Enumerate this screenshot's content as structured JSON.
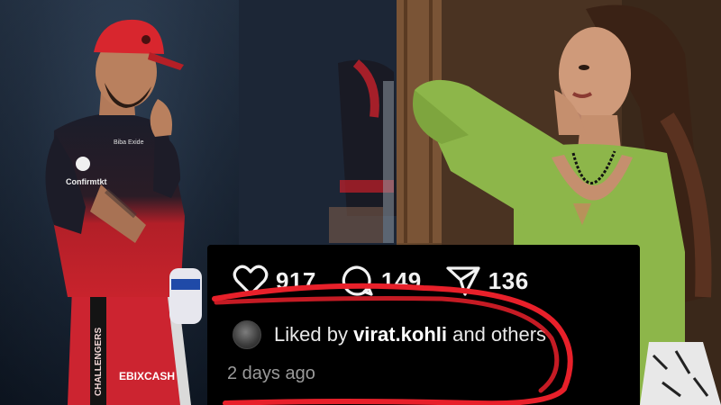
{
  "post": {
    "likes": "917",
    "comments": "149",
    "shares": "136",
    "liked_prefix": "Liked by ",
    "liked_user": "virat.kohli",
    "liked_suffix": " and others",
    "timestamp": "2 days ago"
  },
  "jersey": {
    "sponsor_chest": "Confirmtkt",
    "sponsor_sleeve": "Biba Exide",
    "sponsor_shorts": "EBIXCASH",
    "brand_side": "CHALLENGERS"
  },
  "icons": {
    "like": "heart-outline-icon",
    "comment": "speech-bubble-icon",
    "share": "paper-plane-icon"
  },
  "colors": {
    "insta_bg": "#000000",
    "text": "#f2f2f2",
    "timestamp": "#9a9a9a",
    "highlight_circle": "#e8202a",
    "jersey_red": "#c8202a",
    "cap_red": "#d8262e",
    "top_green": "#8db64a"
  }
}
